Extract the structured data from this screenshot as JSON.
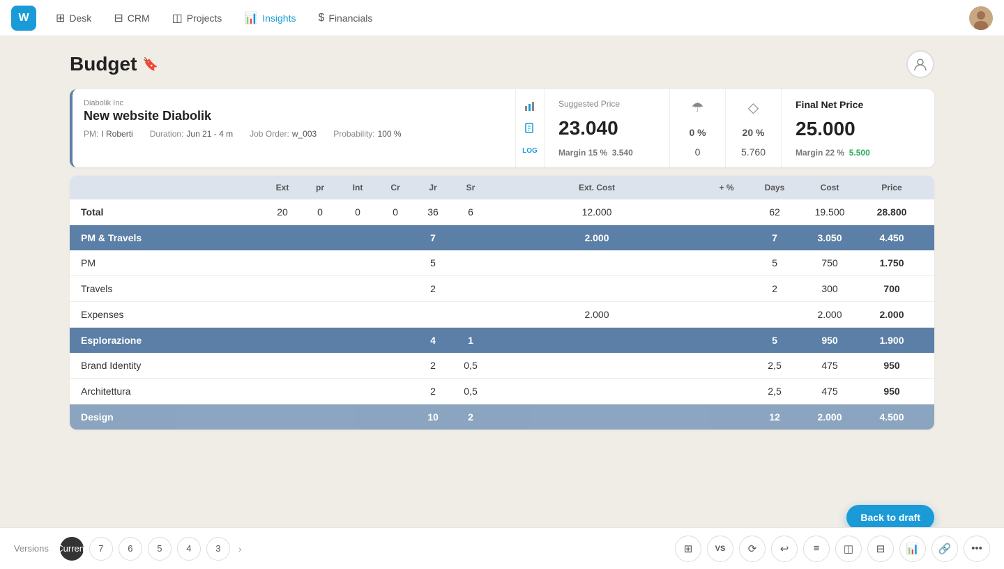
{
  "app": {
    "logo": "W",
    "nav": [
      {
        "id": "desk",
        "label": "Desk",
        "icon": "⊞"
      },
      {
        "id": "crm",
        "label": "CRM",
        "icon": "⊟"
      },
      {
        "id": "projects",
        "label": "Projects",
        "icon": "◫"
      },
      {
        "id": "insights",
        "label": "Insights",
        "icon": "📊",
        "active": true
      },
      {
        "id": "financials",
        "label": "Financials",
        "icon": "$"
      }
    ]
  },
  "page": {
    "title": "Budget",
    "title_icon": "🔖"
  },
  "project": {
    "company": "Diabolik Inc",
    "name": "New website Diabolik",
    "pm_label": "PM:",
    "pm_value": "I Roberti",
    "duration_label": "Duration:",
    "duration_value": "Jun 21 - 4 m",
    "probability_label": "Probability:",
    "probability_value": "100 %",
    "job_order_label": "Job Order:",
    "job_order_value": "w_003"
  },
  "suggested_price": {
    "label": "Suggested Price",
    "value": "23.040",
    "margin_label": "Margin",
    "margin_pct": "15 %",
    "margin_value": "3.540"
  },
  "mid1": {
    "icon": "☂",
    "pct": "0 %",
    "val": "0"
  },
  "mid2": {
    "icon": "◇",
    "pct": "20 %",
    "val": "5.760"
  },
  "final_price": {
    "label": "Final Net Price",
    "value": "25.000",
    "margin_label": "Margin",
    "margin_pct": "22 %",
    "margin_value": "5.500"
  },
  "table": {
    "headers": [
      "",
      "Ext",
      "pr",
      "Int",
      "Cr",
      "Jr",
      "Sr",
      "Ext. Cost",
      "+ %",
      "Days",
      "Cost",
      "Price"
    ],
    "total_row": {
      "label": "Total",
      "ext": "20",
      "pr": "0",
      "int": "0",
      "cr": "0",
      "jr": "36",
      "sr": "6",
      "ext_cost": "12.000",
      "plus_pct": "",
      "days": "62",
      "cost": "19.500",
      "price": "28.800"
    },
    "sections": [
      {
        "id": "pm_travels",
        "label": "PM & Travels",
        "ext": "",
        "pr": "",
        "int": "",
        "cr": "",
        "jr": "7",
        "sr": "",
        "ext_cost": "2.000",
        "plus_pct": "",
        "days": "7",
        "cost": "3.050",
        "price": "4.450",
        "rows": [
          {
            "label": "PM",
            "ext": "",
            "pr": "",
            "int": "",
            "cr": "",
            "jr": "5",
            "sr": "",
            "ext_cost": "",
            "plus_pct": "",
            "days": "5",
            "cost": "750",
            "price": "1.750"
          },
          {
            "label": "Travels",
            "ext": "",
            "pr": "",
            "int": "",
            "cr": "",
            "jr": "2",
            "sr": "",
            "ext_cost": "",
            "plus_pct": "",
            "days": "2",
            "cost": "300",
            "price": "700"
          },
          {
            "label": "Expenses",
            "ext": "",
            "pr": "",
            "int": "",
            "cr": "",
            "jr": "",
            "sr": "",
            "ext_cost": "2.000",
            "plus_pct": "",
            "days": "",
            "cost": "2.000",
            "price": "2.000"
          }
        ]
      },
      {
        "id": "esplorazione",
        "label": "Esplorazione",
        "ext": "",
        "pr": "",
        "int": "",
        "cr": "",
        "jr": "4",
        "sr": "1",
        "ext_cost": "",
        "plus_pct": "",
        "days": "5",
        "cost": "950",
        "price": "1.900",
        "rows": [
          {
            "label": "Brand Identity",
            "ext": "",
            "pr": "",
            "int": "",
            "cr": "",
            "jr": "2",
            "sr": "0,5",
            "ext_cost": "",
            "plus_pct": "",
            "days": "2,5",
            "cost": "475",
            "price": "950"
          },
          {
            "label": "Architettura",
            "ext": "",
            "pr": "",
            "int": "",
            "cr": "",
            "jr": "2",
            "sr": "0,5",
            "ext_cost": "",
            "plus_pct": "",
            "days": "2,5",
            "cost": "475",
            "price": "950"
          }
        ]
      },
      {
        "id": "design",
        "label": "Design",
        "ext": "",
        "pr": "",
        "int": "",
        "cr": "",
        "jr": "10",
        "sr": "2",
        "ext_cost": "",
        "plus_pct": "",
        "days": "12",
        "cost": "2.000",
        "price": "4.500",
        "rows": []
      }
    ]
  },
  "versions": {
    "label": "Versions",
    "current": {
      "label": "Current"
    },
    "list": [
      "7",
      "6",
      "5",
      "4",
      "3"
    ]
  },
  "toolbar": {
    "back_to_draft": "Back to draft",
    "tools": [
      "⊞",
      "VS",
      "⟲",
      "↩",
      "≡",
      "◫",
      "⊟",
      "📊",
      "🔗",
      "•••"
    ]
  }
}
